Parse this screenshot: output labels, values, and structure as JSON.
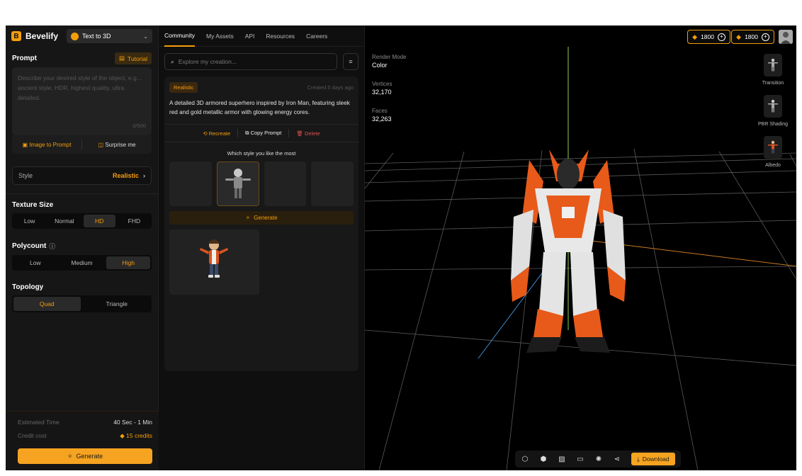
{
  "brand": {
    "name": "Bevelify",
    "logo_letter": "B"
  },
  "mode_select": {
    "label": "Text to 3D"
  },
  "prompt": {
    "title": "Prompt",
    "tutorial_label": "Tutorial",
    "placeholder": "Describe your desired style of the object, e.g... ancient style, HDR, highest quality, ultra detailed.",
    "counter": "0/500",
    "image_to_prompt": "Image to Prompt",
    "surprise_me": "Surprise me"
  },
  "style": {
    "label": "Style",
    "value": "Realistic"
  },
  "texture_size": {
    "title": "Texture Size",
    "options": [
      "Low",
      "Normal",
      "HD",
      "FHD"
    ],
    "selected": "HD"
  },
  "polycount": {
    "title": "Polycount",
    "options": [
      "Low",
      "Medium",
      "High"
    ],
    "selected": "High"
  },
  "topology": {
    "title": "Topology",
    "options": [
      "Quad",
      "Triangle"
    ],
    "selected": "Quad"
  },
  "estimate": {
    "time_label": "Estimated Time",
    "time_value": "40 Sec - 1 Min",
    "credit_label": "Credit cost",
    "credit_value": "15 credits"
  },
  "generate_label": "Generate",
  "nav_tabs": [
    "Community",
    "My Assets",
    "API",
    "Resources",
    "Careers"
  ],
  "active_tab": "Community",
  "search": {
    "placeholder": "Explore my creation..."
  },
  "creation": {
    "badge": "Realistic",
    "created": "Created 5 days ago",
    "description": "A detailed 3D armored superhero inspired by Iron Man, featuring sleek red and gold metallic armor with glowing energy cores.",
    "actions": {
      "recreate": "Recreate",
      "copy_prompt": "Copy Prompt",
      "delete": "Delete"
    },
    "style_question": "Which style you like the most",
    "generate_label": "Generate"
  },
  "credits": [
    {
      "value": "1800"
    },
    {
      "value": "1800"
    }
  ],
  "render_stats": {
    "render_mode_label": "Render Mode",
    "render_mode_value": "Color",
    "vertices_label": "Vertices",
    "vertices_value": "32,170",
    "faces_label": "Faces",
    "faces_value": "32,263"
  },
  "view_modes": [
    "Transition",
    "PBR Shading",
    "Albedo"
  ],
  "download_label": "Download",
  "colors": {
    "accent": "#f59e0b",
    "panel": "#161616",
    "viewport": "#000000",
    "danger": "#e05050"
  }
}
